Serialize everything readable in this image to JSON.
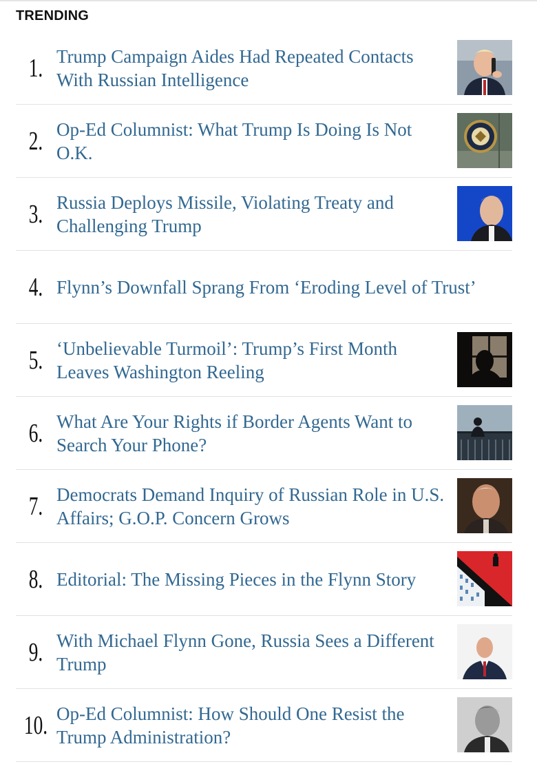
{
  "section": {
    "title": "TRENDING"
  },
  "items": [
    {
      "rank": "1.",
      "headline": "Trump Campaign Aides Had Repeated Contacts With Russian Intelligence",
      "thumb": "man-on-phone-photo"
    },
    {
      "rank": "2.",
      "headline": "Op-Ed Columnist: What Trump Is Doing Is Not O.K.",
      "thumb": "presidential-seal-photo"
    },
    {
      "rank": "3.",
      "headline": "Russia Deploys Missile, Violating Treaty and Challenging Trump",
      "thumb": "man-blue-background-photo"
    },
    {
      "rank": "4.",
      "headline": "Flynn’s Downfall Sprang From ‘Eroding Level of Trust’",
      "thumb": ""
    },
    {
      "rank": "5.",
      "headline": "‘Unbelievable Turmoil’: Trump’s First Month Leaves Washington Reeling",
      "thumb": "silhouette-window-photo"
    },
    {
      "rank": "6.",
      "headline": "What Are Your Rights if Border Agents Want to Search Your Phone?",
      "thumb": "airport-silhouette-photo"
    },
    {
      "rank": "7.",
      "headline": "Democrats Demand Inquiry of Russian Role in U.S. Affairs; G.O.P. Concern Grows",
      "thumb": "senator-portrait-photo"
    },
    {
      "rank": "8.",
      "headline": "Editorial: The Missing Pieces in the Flynn Story",
      "thumb": "red-illustration"
    },
    {
      "rank": "9.",
      "headline": "With Michael Flynn Gone, Russia Sees a Different Trump",
      "thumb": "man-in-suit-photo"
    },
    {
      "rank": "10.",
      "headline": "Op-Ed Columnist: How Should One Resist the Trump Administration?",
      "thumb": "bw-portrait-photo"
    }
  ]
}
